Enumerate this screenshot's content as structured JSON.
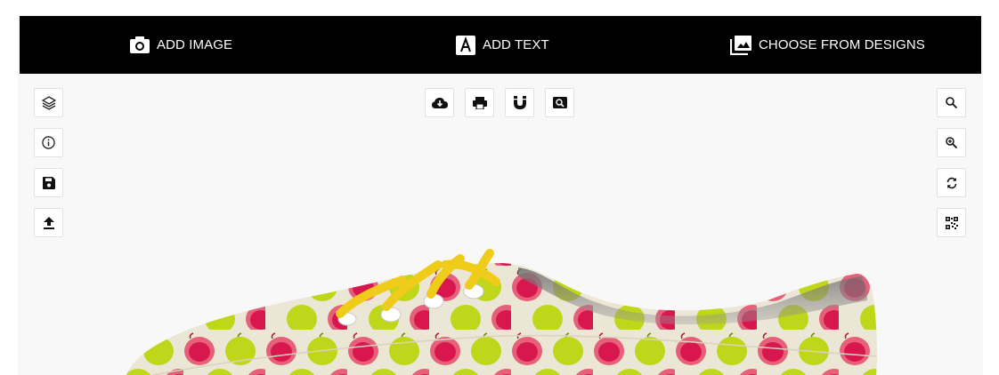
{
  "toolbar": {
    "add_image_label": "ADD IMAGE",
    "add_text_label": "ADD TEXT",
    "choose_designs_label": "CHOOSE FROM DESIGNS"
  },
  "icons": {
    "left": [
      "layers-icon",
      "info-icon",
      "save-icon",
      "upload-icon"
    ],
    "center": [
      "cloud-download-icon",
      "print-icon",
      "magnet-icon",
      "preview-icon"
    ],
    "right": [
      "search-icon",
      "zoom-in-icon",
      "refresh-icon",
      "qr-code-icon"
    ]
  },
  "colors": {
    "topbar": "#000000",
    "canvas": "#f8f8f8",
    "shoe_base": "#ece6d6",
    "apple_red": "#d8174f",
    "apple_red_light": "#e6607a",
    "apple_green": "#bfd61a",
    "laces": "#f0cc1a"
  }
}
